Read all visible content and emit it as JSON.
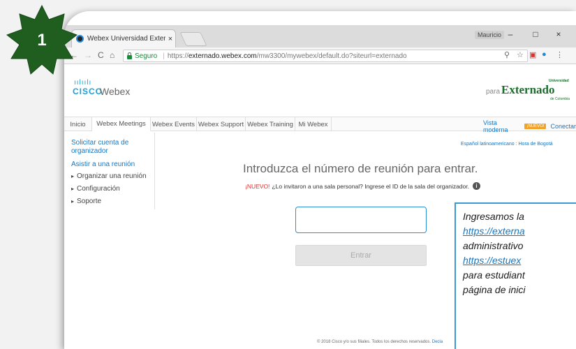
{
  "badge": {
    "number": "1",
    "color": "#1f5e1f"
  },
  "browser": {
    "tab_title": "Webex Universidad Extern",
    "tab_close": "×",
    "profile_name": "Mauricio",
    "window_controls": {
      "minimize": "–",
      "maximize": "□",
      "close": "×"
    },
    "nav": {
      "back": "←",
      "forward": "→",
      "reload": "C",
      "home": "⌂"
    },
    "secure_label": "Seguro",
    "url_proto": "https://",
    "url_host": "externado.webex.com",
    "url_path": "/mw3300/mywebex/default.do?siteurl=externado",
    "toolbar_icons": [
      "zoom-icon",
      "star-icon",
      "extension-icon",
      "account-icon",
      "menu-icon"
    ]
  },
  "webex": {
    "cisco_bars": "ıılıılı",
    "cisco_word": "CISCO",
    "webex_word": "Webex",
    "para": "para",
    "externado_small": "Universidad",
    "externado_big": "Externado",
    "externado_sub": "de Colombia",
    "tabs": [
      "Inicio",
      "Webex Meetings",
      "Webex Events",
      "Webex Support",
      "Webex Training",
      "Mi Webex"
    ],
    "active_tab": "Webex Meetings",
    "vista_moderna": "Vista moderna",
    "nuevo_badge": "¡NUEVO!",
    "conectar": "Conectar",
    "sidebar": {
      "solicitar_1": "Solicitar cuenta de",
      "solicitar_2": "organizador",
      "asistir": "Asistir a una reunión",
      "items": [
        "Organizar una reunión",
        "Configuración",
        "Soporte"
      ]
    },
    "locale": "Español latinoamericano : Hora de Bogotá",
    "headline": "Introduzca el número de reunión para entrar.",
    "nuevo_red": "¡NUEVO!",
    "nuevo_text": "¿Lo invitaron a una sala personal? Ingrese el ID de la sala del organizador.",
    "meeting_input_value": "",
    "enter_button": "Entrar",
    "footer": "© 2018 Cisco y/o sus filiales. Todos los derechos reservados.",
    "footer_link": "Decla"
  },
  "callout": {
    "lines": [
      "Ingresamos la",
      "https://externa",
      "administrativo",
      "https://estuex",
      "para estudiant",
      "página de inici"
    ],
    "border_color": "#3a9ad4"
  }
}
